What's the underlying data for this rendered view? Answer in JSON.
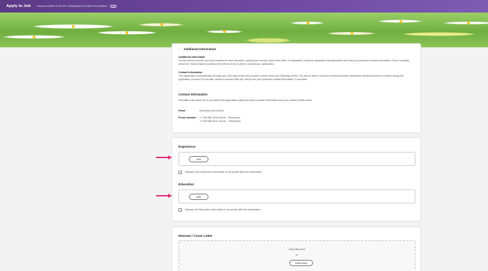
{
  "topbar": {
    "title": "Apply to Job",
    "subtitle": "Internal DIRECTOR OF COMMUNICATIONS PLANNING",
    "badge_icon": "view-icon"
  },
  "additional_info": {
    "header": "Additional Information",
    "intro_title": "Additional Information",
    "intro_text": "On this screen provide your work experience and education, upload your resume (and cover letter, if requested), complete application questionnaires and add your personal contact information. Once complete, select the Submit button located at the bottom of the screen to submit your application.",
    "contact_title": "Contact Information",
    "contact_text": "Your application automatically includes your UW work email and a phone number from your Workday profile. You will be able to add your personal contact information (email and phone number) during the application process if a recruiter needs to connect with you; they'll use your personal contact information, if provided.",
    "contact_section_title": "Contact Information",
    "contact_section_text": "Recruiters can reach out to you about this application using the public contact information from your worker profile below.",
    "email_label": "Email",
    "email_value": "kevin@uw.edu (Work)",
    "phone_label": "Phone Number",
    "phone_1": "+1 206 685 3815 (Work - Telephone)",
    "phone_2": "+1 018 683 6611 (Home - Telephone)"
  },
  "experience": {
    "title": "Experience",
    "add_label": "Add",
    "replace_label": "Replace the Experience information in my profile with this information"
  },
  "education": {
    "title": "Education",
    "add_label": "Add",
    "replace_label": "Replace the Education information in my profile with this information"
  },
  "resume": {
    "title": "Resume / Cover Letter",
    "drop_text": "Drop files here",
    "or_text": "or",
    "select_label": "Select files"
  },
  "colors": {
    "topbar": "#6e4aa0",
    "annotation_arrow": "#e0307c"
  }
}
